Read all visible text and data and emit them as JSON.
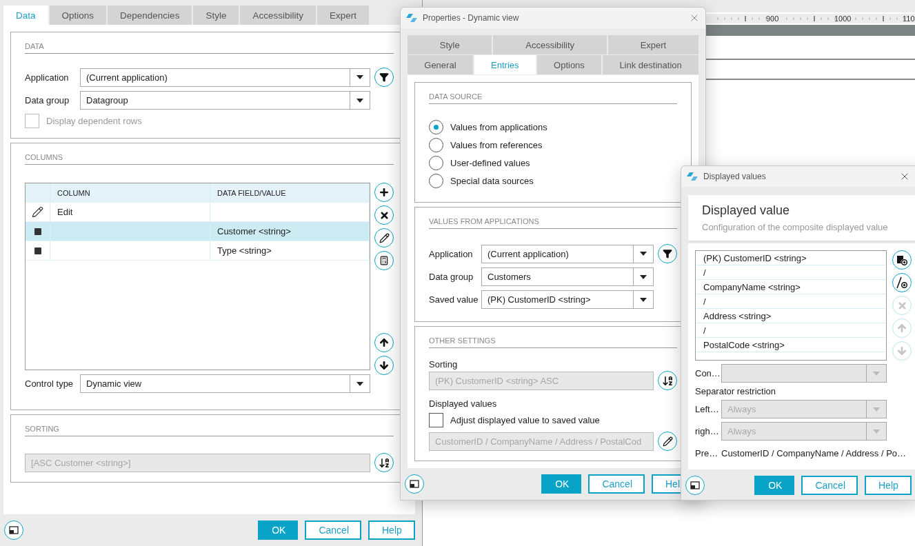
{
  "main_dialog": {
    "tabs": [
      {
        "label": "Data",
        "selected": true
      },
      {
        "label": "Options",
        "selected": false
      },
      {
        "label": "Dependencies",
        "selected": false
      },
      {
        "label": "Style",
        "selected": false
      },
      {
        "label": "Accessibility",
        "selected": false
      },
      {
        "label": "Expert",
        "selected": false
      }
    ],
    "data_section": {
      "heading": "DATA",
      "application": {
        "label": "Application",
        "value": "(Current application)"
      },
      "data_group": {
        "label": "Data group",
        "value": "Datagroup"
      },
      "display_dependent_rows": {
        "label": "Display dependent rows",
        "checked": false,
        "disabled": true
      }
    },
    "columns_section": {
      "heading": "COLUMNS",
      "table": {
        "columns": [
          "COLUMN",
          "DATA FIELD/VALUE"
        ],
        "rows": [
          {
            "kind": "edit",
            "column": "Edit",
            "selected": false
          },
          {
            "kind": "field",
            "value": "Customer <string>",
            "selected": true
          },
          {
            "kind": "field",
            "value": "Type <string>",
            "selected": false
          }
        ]
      },
      "control_type": {
        "label": "Control type",
        "value": "Dynamic view"
      }
    },
    "sorting_section": {
      "heading": "SORTING",
      "value": "[ASC Customer <string>]",
      "disabled": true
    },
    "buttons": [
      {
        "label": "OK",
        "primary": true
      },
      {
        "label": "Cancel",
        "primary": false
      },
      {
        "label": "Help",
        "primary": false
      }
    ]
  },
  "designer": {
    "ruler_labels": [
      "900",
      "1000",
      "110"
    ]
  },
  "properties_dialog": {
    "title": "Properties - Dynamic view",
    "tab_rows": [
      {
        "tabs": [
          {
            "label": "Style",
            "selected": false
          },
          {
            "label": "Accessibility",
            "selected": false
          },
          {
            "label": "Expert",
            "selected": false
          }
        ]
      },
      {
        "tabs": [
          {
            "label": "General",
            "selected": false
          },
          {
            "label": "Entries",
            "selected": true
          },
          {
            "label": "Options",
            "selected": false
          },
          {
            "label": "Link destination",
            "selected": false
          }
        ]
      }
    ],
    "data_source": {
      "heading": "DATA SOURCE",
      "options": [
        {
          "label": "Values from applications",
          "selected": true
        },
        {
          "label": "Values from references",
          "selected": false
        },
        {
          "label": "User-defined values",
          "selected": false
        },
        {
          "label": "Special data sources",
          "selected": false
        }
      ]
    },
    "values_from_applications": {
      "heading": "VALUES FROM APPLICATIONS",
      "fields": [
        {
          "label": "Application",
          "value": "(Current application)",
          "filter": true
        },
        {
          "label": "Data group",
          "value": "Customers",
          "filter": false
        },
        {
          "label": "Saved value",
          "value": "(PK) CustomerID <string>",
          "filter": false
        }
      ]
    },
    "other_settings": {
      "heading": "OTHER SETTINGS",
      "sorting": {
        "label": "Sorting",
        "value": "(PK) CustomerID <string> ASC",
        "disabled": true
      },
      "displayed_values": {
        "label": "Displayed values",
        "adjust": {
          "label": "Adjust displayed value to saved value",
          "checked": false
        },
        "value": "CustomerID / CompanyName / Address / PostalCod",
        "disabled": true
      }
    },
    "buttons": [
      {
        "label": "OK",
        "primary": true
      },
      {
        "label": "Cancel",
        "primary": false
      },
      {
        "label": "Hel",
        "primary": false
      }
    ]
  },
  "displayed_values_dialog": {
    "title": "Displayed values",
    "heading": "Displayed value",
    "subtitle": "Configuration of the composite displayed value",
    "items": [
      "(PK) CustomerID <string>",
      "/",
      "CompanyName <string>",
      "/",
      "Address <string>",
      "/",
      "PostalCode <string>"
    ],
    "tools": [
      {
        "kind": "add-field",
        "disabled": false
      },
      {
        "kind": "add-separator",
        "disabled": false
      },
      {
        "kind": "delete",
        "disabled": true
      },
      {
        "kind": "move-up",
        "disabled": true
      },
      {
        "kind": "move-down",
        "disabled": true
      }
    ],
    "condition": {
      "label": "Con…",
      "disabled": true
    },
    "separator_restriction": {
      "label": "Separator restriction",
      "left": {
        "label": "Left…",
        "value": "Always",
        "disabled": true
      },
      "right": {
        "label": "righ…",
        "value": "Always",
        "disabled": true
      }
    },
    "preview": {
      "label": "Pre…",
      "value": "CustomerID / CompanyName / Address / Po…"
    },
    "buttons": [
      {
        "label": "OK",
        "primary": true
      },
      {
        "label": "Cancel",
        "primary": false
      },
      {
        "label": "Help",
        "primary": false
      }
    ]
  }
}
